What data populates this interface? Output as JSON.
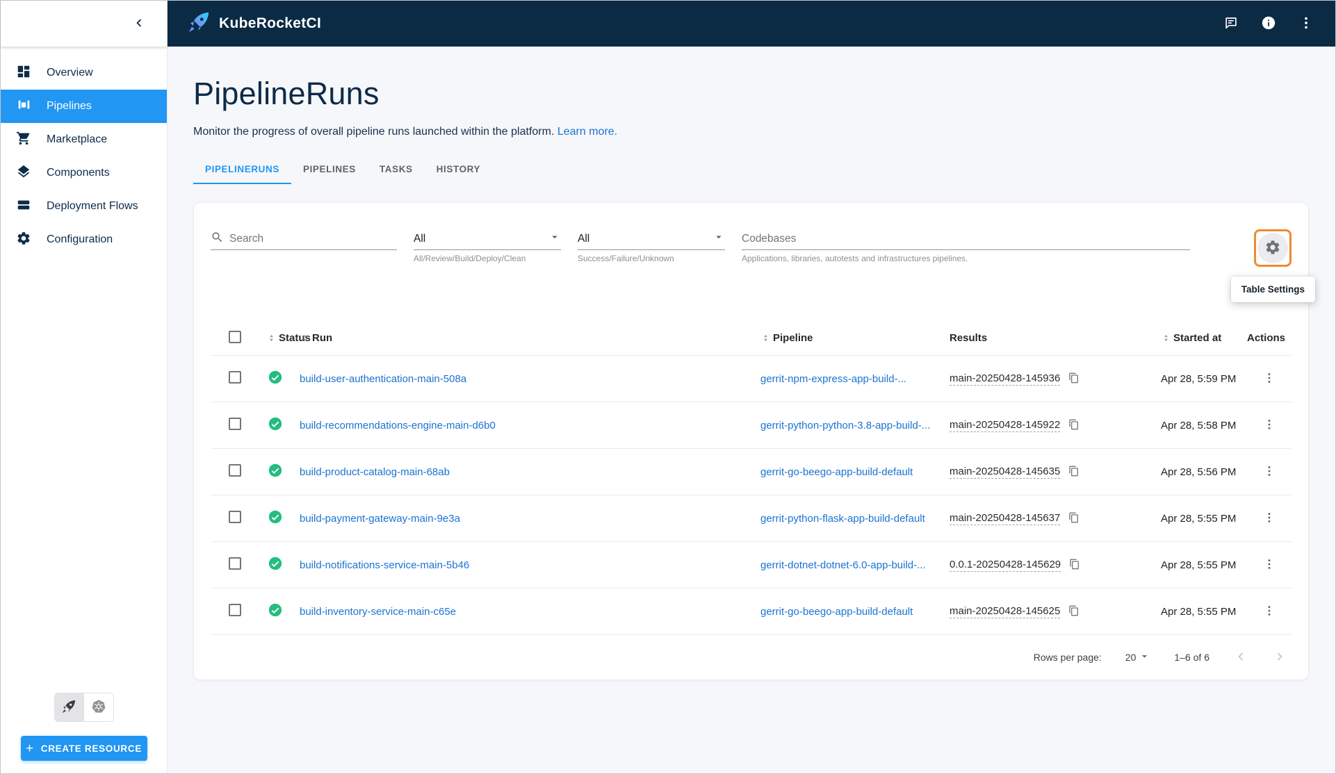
{
  "app": {
    "title": "KubeRocketCI"
  },
  "sidebar": {
    "items": [
      {
        "label": "Overview",
        "active": false
      },
      {
        "label": "Pipelines",
        "active": true
      },
      {
        "label": "Marketplace",
        "active": false
      },
      {
        "label": "Components",
        "active": false
      },
      {
        "label": "Deployment Flows",
        "active": false
      },
      {
        "label": "Configuration",
        "active": false
      }
    ],
    "runtime_toggle": {
      "options": [
        "rocket",
        "kubernetes"
      ],
      "selected": "rocket"
    },
    "create_button_label": "CREATE RESOURCE"
  },
  "page": {
    "title": "PipelineRuns",
    "description": "Monitor the progress of overall pipeline runs launched within the platform.",
    "learn_more_label": "Learn more.",
    "tabs": [
      {
        "label": "PIPELINERUNS",
        "active": true
      },
      {
        "label": "PIPELINES",
        "active": false
      },
      {
        "label": "TASKS",
        "active": false
      },
      {
        "label": "HISTORY",
        "active": false
      }
    ]
  },
  "filters": {
    "search": {
      "placeholder": "Search"
    },
    "type_filter": {
      "value": "All",
      "helper": "All/Review/Build/Deploy/Clean"
    },
    "status_filter": {
      "value": "All",
      "helper": "Success/Failure/Unknown"
    },
    "codebases_filter": {
      "placeholder": "Codebases",
      "helper": "Applications, libraries, autotests and infrastructures pipelines."
    },
    "table_settings_tooltip": "Table Settings"
  },
  "table": {
    "columns": {
      "status": "Status",
      "run": "Run",
      "pipeline": "Pipeline",
      "results": "Results",
      "started_at": "Started at",
      "actions": "Actions"
    },
    "rows": [
      {
        "status": "success",
        "run": "build-user-authentication-main-508a",
        "pipeline": "gerrit-npm-express-app-build-...",
        "results": "main-20250428-145936",
        "started_at": "Apr 28, 5:59 PM"
      },
      {
        "status": "success",
        "run": "build-recommendations-engine-main-d6b0",
        "pipeline": "gerrit-python-python-3.8-app-build-...",
        "results": "main-20250428-145922",
        "started_at": "Apr 28, 5:58 PM"
      },
      {
        "status": "success",
        "run": "build-product-catalog-main-68ab",
        "pipeline": "gerrit-go-beego-app-build-default",
        "results": "main-20250428-145635",
        "started_at": "Apr 28, 5:56 PM"
      },
      {
        "status": "success",
        "run": "build-payment-gateway-main-9e3a",
        "pipeline": "gerrit-python-flask-app-build-default",
        "results": "main-20250428-145637",
        "started_at": "Apr 28, 5:55 PM"
      },
      {
        "status": "success",
        "run": "build-notifications-service-main-5b46",
        "pipeline": "gerrit-dotnet-dotnet-6.0-app-build-...",
        "results": "0.0.1-20250428-145629",
        "started_at": "Apr 28, 5:55 PM"
      },
      {
        "status": "success",
        "run": "build-inventory-service-main-c65e",
        "pipeline": "gerrit-go-beego-app-build-default",
        "results": "main-20250428-145625",
        "started_at": "Apr 28, 5:55 PM"
      }
    ]
  },
  "pagination": {
    "rows_per_page_label": "Rows per page:",
    "rows_per_page_value": "20",
    "range_label": "1–6 of 6"
  },
  "icons": {
    "logo": "rocket-icon",
    "topbar": [
      "chat-icon",
      "info-icon",
      "kebab-menu-icon"
    ],
    "sidebar": [
      "dashboard-icon",
      "pipelines-icon",
      "cart-icon",
      "layers-icon",
      "stack-icon",
      "gear-icon"
    ]
  },
  "colors": {
    "header_bg": "#0b2a44",
    "accent_blue": "#2196f3",
    "link_blue": "#1a73d2",
    "success_green": "#23be7e",
    "highlight_orange": "#ef8b2f",
    "page_bg": "#f6f7fa"
  }
}
